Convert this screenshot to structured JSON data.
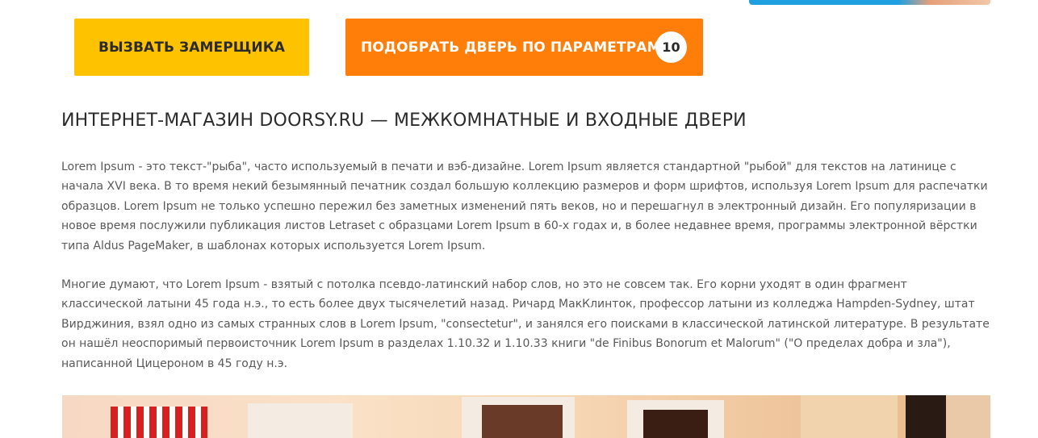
{
  "buttons": {
    "call_measurer_label": "ВЫЗВАТЬ ЗАМЕРЩИКА",
    "pick_door_label": "ПОДОБРАТЬ ДВЕРЬ ПО ПАРАМЕТРАМ",
    "pick_door_count": "10"
  },
  "colors": {
    "yellow_button": "#fec200",
    "orange_button": "#fe7e09",
    "heading_text": "#2b2b2b",
    "body_text": "#5a5a5a"
  },
  "heading": "ИНТЕРНЕТ-МАГАЗИН DOORSY.RU — МЕЖКОМНАТНЫЕ И ВХОДНЫЕ ДВЕРИ",
  "paragraphs": [
    "Lorem Ipsum - это текст-\"рыба\", часто используемый в печати и вэб-дизайне. Lorem Ipsum является стандартной \"рыбой\" для текстов на латинице с начала XVI века. В то время некий безымянный печатник создал большую коллекцию размеров и форм шрифтов, используя Lorem Ipsum для распечатки образцов. Lorem Ipsum не только успешно пережил без заметных изменений пять веков, но и перешагнул в электронный дизайн. Его популяризации в новое время послужили публикация листов Letraset с образцами Lorem Ipsum в 60-х годах и, в более недавнее время, программы электронной вёрстки типа Aldus PageMaker, в шаблонах которых используется Lorem Ipsum.",
    "Многие думают, что Lorem Ipsum - взятый с потолка псевдо-латинский набор слов, но это не совсем так. Его корни уходят в один фрагмент классической латыни 45 года н.э., то есть более двух тысячелетий назад. Ричард МакКлинток, профессор латыни из колледжа Hampden-Sydney, штат Вирджиния, взял одно из самых странных слов в Lorem Ipsum, \"consectetur\", и занялся его поисками в классической латинской литературе. В результате он нашёл неоспоримый первоисточник Lorem Ipsum в разделах 1.10.32 и 1.10.33 книги \"de Finibus Bonorum et Malorum\" (\"О пределах добра и зла\"), написанной Цицероном в 45 году н.э."
  ]
}
